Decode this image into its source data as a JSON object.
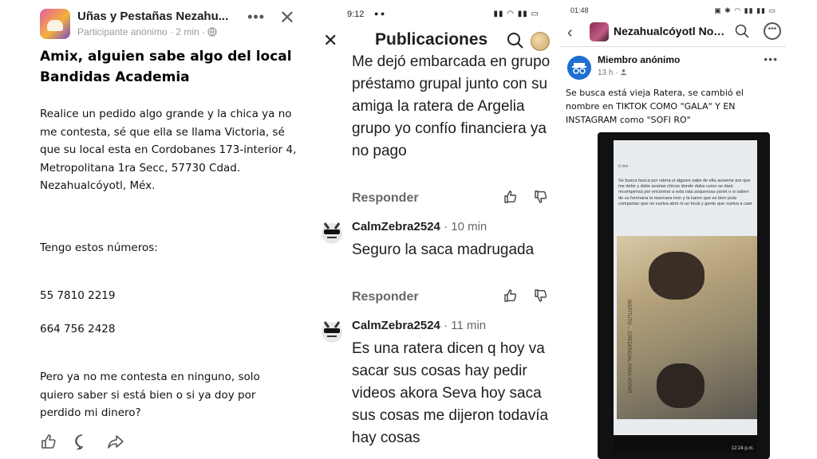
{
  "panel1": {
    "group_name": "Uñas y Pestañas Nezahu...",
    "author": "Participante anónimo",
    "time": "· 2 min ·",
    "title": "Amix, alguien sabe algo del local Bandidas Academia",
    "para1": "Realice un pedido algo grande y la chica ya no me contesta, sé que ella se llama Victoria, sé que su local esta en Cordobanes 173-interior 4, Metropolitana 1ra Secc, 57730 Cdad. Nezahualcóyotl, Méx.",
    "para2": "Tengo estos números:",
    "phone1": "55 7810 2219",
    "phone2": "664 756 2428",
    "para3": "Pero ya no me contesta en ninguno, solo quiero saber si está bien o si ya doy por perdido mi dinero?"
  },
  "panel2": {
    "status_time": "9:12",
    "header_title": "Publicaciones",
    "comment1_text": "Me dejó embarcada en grupo préstamo grupal junto con su amiga la ratera de Argelia grupo yo confío financiera ya no pago",
    "reply_label": "Responder",
    "comment2_user": "CalmZebra2524",
    "comment2_time": "· 10 min",
    "comment2_text": "Seguro la saca madrugada",
    "comment3_user": "CalmZebra2524",
    "comment3_time": "· 11 min",
    "comment3_text": "Es una ratera dicen q hoy va sacar sus cosas hay pedir videos akora Seva hoy saca sus cosas me dijeron todavía hay cosas"
  },
  "panel3": {
    "status_time": "01:48",
    "group_name": "Nezahualcóyotl Not...",
    "author": "Miembro anónimo",
    "time": "13 h ·",
    "post_text": "Se busca está vieja Ratera, se cambió el nombre en TIKTOK COMO \"GALA\" Y EN INSTAGRAM como \"SOFI RO\"",
    "shot_meta": "6 min ·",
    "shot_text": "Se busca busca por ratera si alguien sabe de ella aviseme por que me debe y debe avarias chicas donde daba curso se dará recompensa por encontrar a esta rata asquerosa yanet o si saben de su hermana la marrrana ivon y la karen que es bien puta compartan que no vuelva abrir ni un local y gente que vuelva a caer",
    "card_label": "INSTITUTO ... CREDENCIAL PARA VOTAR",
    "clock": "12:24 p.m."
  }
}
